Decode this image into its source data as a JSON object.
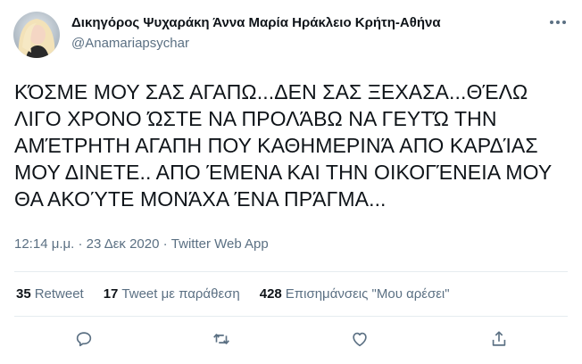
{
  "user": {
    "display_name": "Δικηγόρος Ψυχαράκη Άννα Μαρία Ηράκλειο Κρήτη-Αθήνα",
    "handle": "@Anamariapsychar",
    "avatar_icon": "profile-photo"
  },
  "tweet": {
    "text": "ΚΌΣΜΕ ΜΟΥ ΣΑΣ ΑΓΑΠΩ...ΔΕΝ ΣΑΣ ΞΕΧΑΣΑ...ΘΈΛΩ\nΛΙΓΟ ΧΡΟΝΟ ΏΣΤΕ ΝΑ ΠΡΟΛΆΒΩ ΝΑ ΓΕΥΤΏ ΤΗΝ\nΑΜΈΤΡΗΤΗ ΑΓΑΠΗ ΠΟΥ ΚΑΘΗΜΕΡΙΝΆ ΑΠΟ ΚΑΡΔΊΑΣ\nΜΟΥ ΔΙΝΕΤΕ.. ΑΠΟ ΈΜΕΝΑ ΚΑΙ ΤΗΝ ΟΙΚΟΓΈΝΕΙΑ ΜΟΥ\nΘΑ ΑΚΟΎΤΕ ΜΟΝΆΧΑ ΈΝΑ ΠΡΆΓΜΑ..."
  },
  "meta": {
    "time": "12:14 μ.μ.",
    "separator": " · ",
    "date": "23 Δεκ 2020",
    "source": "Twitter Web App"
  },
  "stats": {
    "retweets_count": "35",
    "retweets_label": "Retweet",
    "quotes_count": "17",
    "quotes_label": "Tweet με παράθεση",
    "likes_count": "428",
    "likes_label": "Επισημάνσεις \"Μου αρέσει\""
  },
  "actions": [
    "reply-icon",
    "retweet-icon",
    "like-icon",
    "share-icon"
  ],
  "colors": {
    "text": "#0f1419",
    "secondary": "#5b7083",
    "icon": "#5b7083",
    "divider": "#e6ecf0"
  }
}
